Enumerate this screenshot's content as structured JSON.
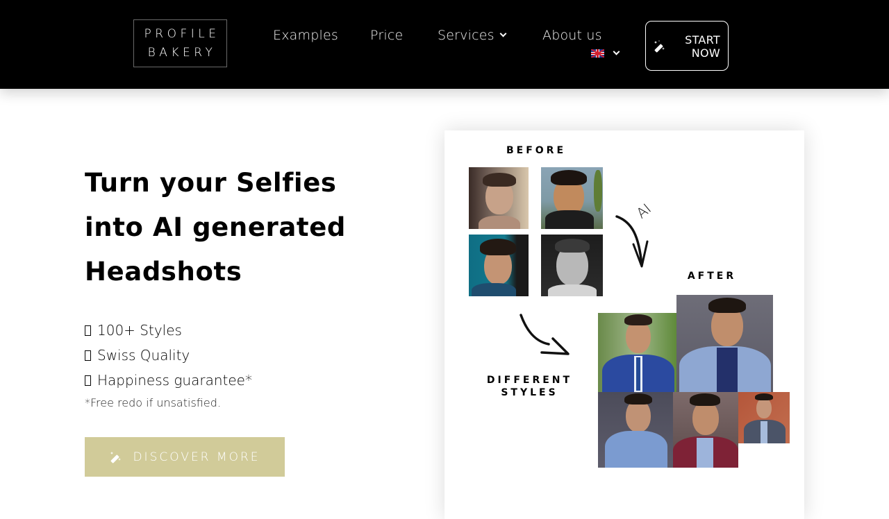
{
  "header": {
    "logo_line1": "PROFILE",
    "logo_line2": "BAKERY",
    "nav": [
      {
        "label": "Examples"
      },
      {
        "label": "Price"
      },
      {
        "label": "Services",
        "has_dropdown": true
      },
      {
        "label": "About us"
      }
    ],
    "language": {
      "selected": "English (UK)",
      "icon": "uk-flag-icon"
    },
    "cta": {
      "line1": "START",
      "line2": "NOW",
      "icon": "magic-wand-icon"
    }
  },
  "hero": {
    "title_line1": "Turn your Selfies",
    "title_line2": "into AI generated",
    "title_line3": "Headshots",
    "features": [
      {
        "icon": "box-glyph-icon",
        "text": "100+ Styles"
      },
      {
        "icon": "box-glyph-icon",
        "text": "Swiss Quality"
      },
      {
        "icon": "box-glyph-icon",
        "text": "Happiness guarantee*"
      }
    ],
    "footnote": "*Free redo if unsatisfied.",
    "discover_button": {
      "label": "DISCOVER MORE",
      "icon": "magic-wand-icon"
    }
  },
  "showcase": {
    "before_label": "BEFORE",
    "ai_label": "AI",
    "after_label": "AFTER",
    "styles_label_line1": "DIFFERENT",
    "styles_label_line2": "STYLES",
    "before_photos": [
      "selfie-1",
      "selfie-2",
      "selfie-3",
      "selfie-4"
    ],
    "after_photos": [
      "headshot-outdoor-suit",
      "headshot-light-blue-blazer",
      "headshot-blue-shirt",
      "headshot-burgundy-blazer",
      "headshot-orange-background"
    ]
  },
  "colors": {
    "header_bg": "#000000",
    "accent_button": "#d1cb99",
    "text": "#000000"
  }
}
